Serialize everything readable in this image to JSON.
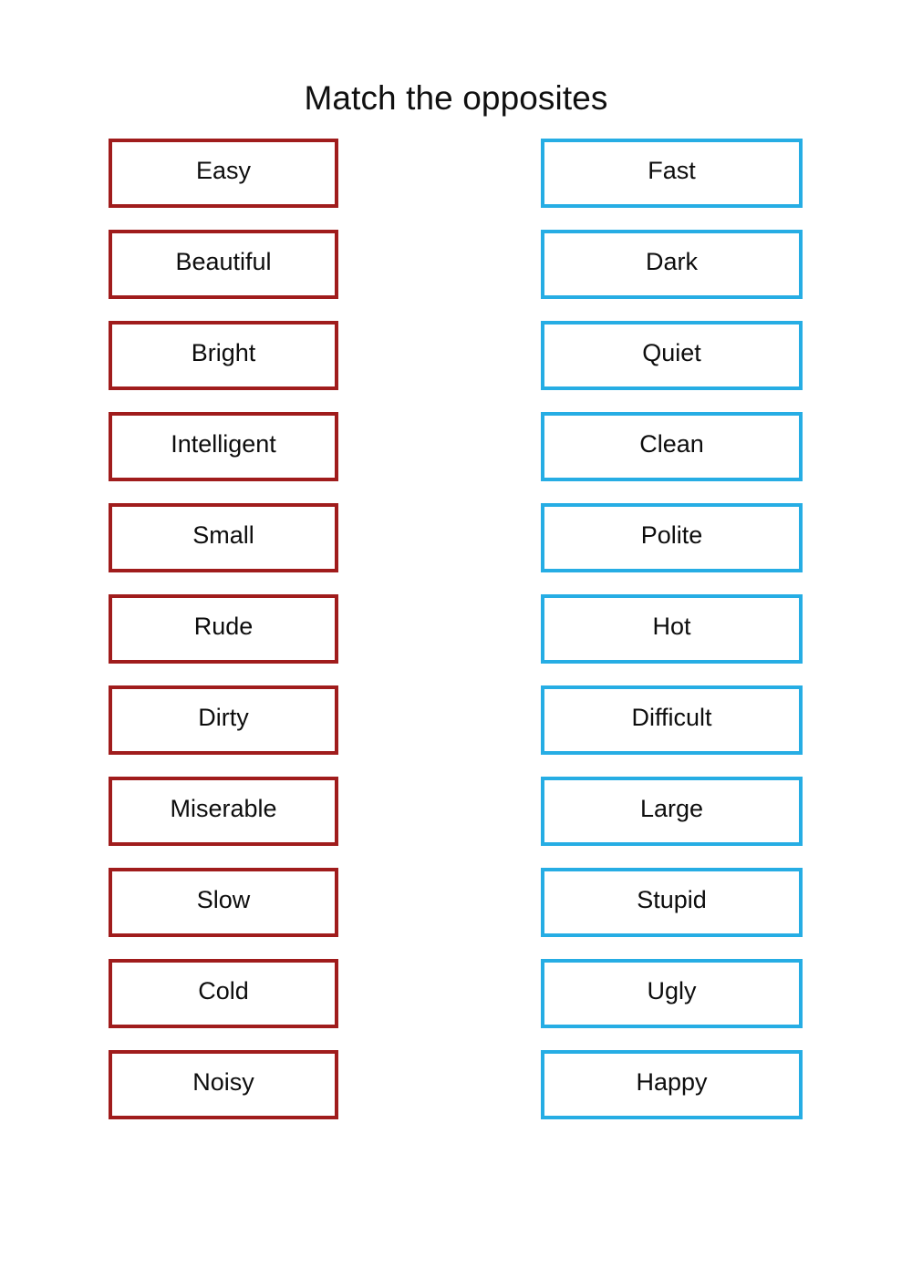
{
  "worksheet": {
    "title": "Match the opposites",
    "left_column": {
      "accent_color": "#a01c1c",
      "items": [
        {
          "label": "Easy"
        },
        {
          "label": "Beautiful"
        },
        {
          "label": "Bright"
        },
        {
          "label": "Intelligent"
        },
        {
          "label": "Small"
        },
        {
          "label": "Rude"
        },
        {
          "label": "Dirty"
        },
        {
          "label": "Miserable"
        },
        {
          "label": "Slow"
        },
        {
          "label": "Cold"
        },
        {
          "label": "Noisy"
        }
      ]
    },
    "right_column": {
      "accent_color": "#26ade4",
      "items": [
        {
          "label": "Fast"
        },
        {
          "label": "Dark"
        },
        {
          "label": "Quiet"
        },
        {
          "label": "Clean"
        },
        {
          "label": "Polite"
        },
        {
          "label": "Hot"
        },
        {
          "label": "Difficult"
        },
        {
          "label": "Large"
        },
        {
          "label": "Stupid"
        },
        {
          "label": "Ugly"
        },
        {
          "label": "Happy"
        }
      ]
    }
  }
}
